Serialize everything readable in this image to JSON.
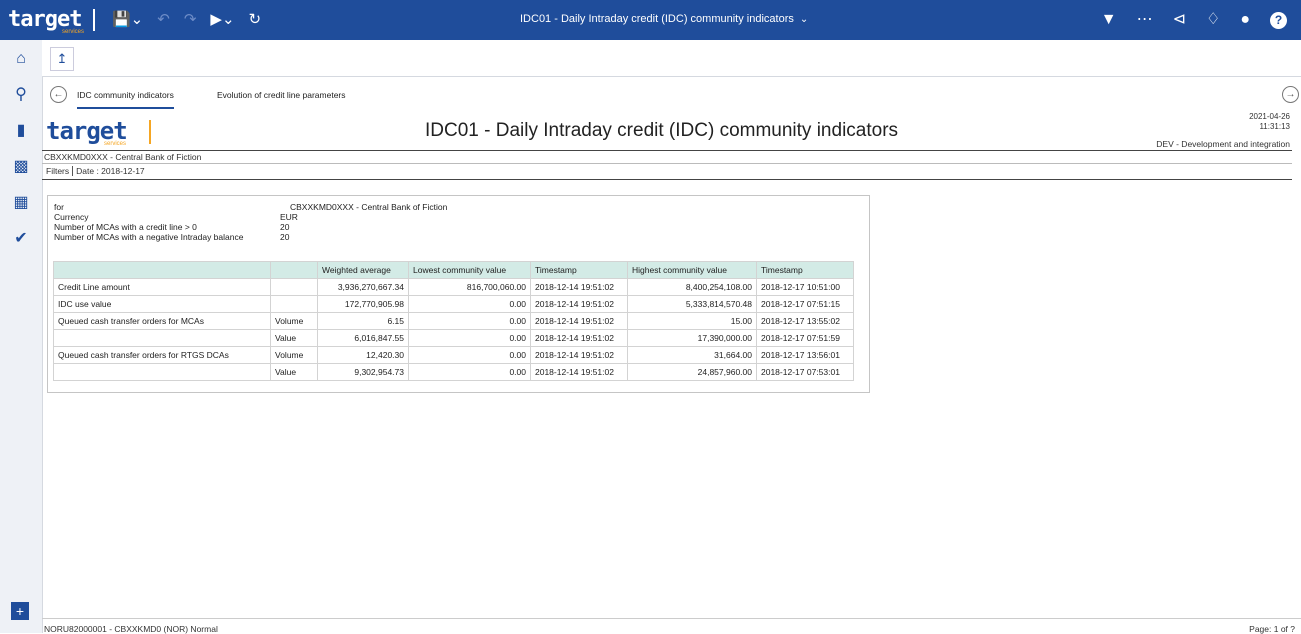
{
  "topbar": {
    "logo_text": "target",
    "logo_sub": "services",
    "title": "IDC01 - Daily Intraday credit (IDC) community indicators",
    "icons": [
      "save-icon",
      "undo-icon",
      "redo-icon",
      "run-icon",
      "refresh-icon"
    ],
    "right_icons": [
      "filter-icon",
      "more-icon",
      "share-icon",
      "bell-icon",
      "user-icon",
      "help-icon"
    ],
    "help_label": "?"
  },
  "tabs": [
    {
      "label": "IDC community indicators",
      "active": true
    },
    {
      "label": "Evolution of credit line parameters",
      "active": false
    }
  ],
  "report": {
    "logo_text": "target",
    "logo_sub": "services",
    "title": "IDC01 - Daily Intraday credit (IDC) community indicators",
    "date": "2021-04-26",
    "time": "11:31:13",
    "environment": "DEV - Development and integration",
    "central_bank": "CBXXKMD0XXX - Central Bank of Fiction",
    "filters_label": "Filters",
    "filters_value": "Date : 2018-12-17"
  },
  "info": {
    "for_label": "for",
    "for_value": "CBXXKMD0XXX - Central Bank of Fiction",
    "currency_label": "Currency",
    "currency_value": "EUR",
    "mcas_label": "Number of MCAs with a credit line > 0",
    "mcas_value": "20",
    "neg_label": "Number of MCAs with a negative Intraday balance",
    "neg_value": "20"
  },
  "table": {
    "headers": [
      "",
      "",
      "Weighted average",
      "Lowest community value",
      "Timestamp",
      "Highest community value",
      "Timestamp"
    ],
    "rows": [
      [
        "Credit Line amount",
        "",
        "3,936,270,667.34",
        "816,700,060.00",
        "2018-12-14 19:51:02",
        "8,400,254,108.00",
        "2018-12-17 10:51:00"
      ],
      [
        "IDC use value",
        "",
        "172,770,905.98",
        "0.00",
        "2018-12-14 19:51:02",
        "5,333,814,570.48",
        "2018-12-17 07:51:15"
      ],
      [
        "Queued cash transfer orders for MCAs",
        "Volume",
        "6.15",
        "0.00",
        "2018-12-14 19:51:02",
        "15.00",
        "2018-12-17 13:55:02"
      ],
      [
        "",
        "Value",
        "6,016,847.55",
        "0.00",
        "2018-12-14 19:51:02",
        "17,390,000.00",
        "2018-12-17 07:51:59"
      ],
      [
        "Queued cash transfer orders for RTGS DCAs",
        "Volume",
        "12,420.30",
        "0.00",
        "2018-12-14 19:51:02",
        "31,664.00",
        "2018-12-17 13:56:01"
      ],
      [
        "",
        "Value",
        "9,302,954.73",
        "0.00",
        "2018-12-14 19:51:02",
        "24,857,960.00",
        "2018-12-17 07:53:01"
      ]
    ]
  },
  "footer": {
    "left": "NORU82000001 - CBXXKMD0 (NOR) Normal",
    "right": "Page: 1 of ?"
  }
}
